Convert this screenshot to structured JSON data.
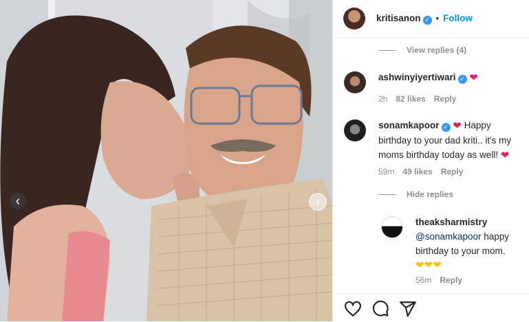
{
  "post": {
    "image_alt": "Photo",
    "prev_label": "‹",
    "next_label": "›"
  },
  "header": {
    "username": "kritisanon",
    "separator": "•",
    "follow_label": "Follow"
  },
  "thread": {
    "view_replies": "View replies (4)",
    "hide_replies": "Hide replies"
  },
  "comments": [
    {
      "username": "ashwinyiyertiwari",
      "text": "",
      "time": "2h",
      "likes": "82 likes",
      "reply": "Reply"
    },
    {
      "username": "sonamkapoor",
      "text_line1": "Happy",
      "text_line2": "birthday to your dad kriti.. it's my",
      "text_line3": "moms birthday today as well!",
      "time": "59m",
      "likes": "49 likes",
      "reply": "Reply"
    }
  ],
  "reply": {
    "username": "theaksharmistry",
    "mention": "@sonamkapoor",
    "text_a": " happy",
    "text_b": "birthday to your mom.",
    "time": "56m",
    "reply": "Reply"
  },
  "colors": {
    "accent": "#0095f6",
    "verified": "#3897f0",
    "heart": "#e0245e",
    "muted": "#8e8e8e"
  },
  "icons": [
    "heart-icon",
    "comment-icon",
    "share-icon",
    "verified-badge-icon"
  ]
}
